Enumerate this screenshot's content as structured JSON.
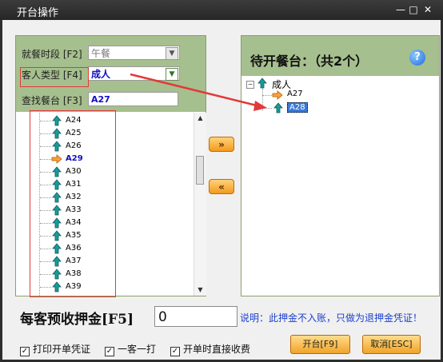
{
  "window": {
    "title": "开台操作",
    "buttons": [
      "—",
      "□",
      "✕"
    ]
  },
  "left_panel": {
    "meal_period": {
      "label": "就餐时段 [F2]",
      "value": "午餐"
    },
    "guest_type": {
      "label": "客人类型 [F4]",
      "value": "成人"
    },
    "find_table": {
      "label": "查找餐台 [F3]",
      "value": "A27"
    },
    "tables": [
      {
        "name": "A24",
        "icon": "up-arrow-icon",
        "selected": false
      },
      {
        "name": "A25",
        "icon": "up-arrow-icon",
        "selected": false
      },
      {
        "name": "A26",
        "icon": "up-arrow-icon",
        "selected": false
      },
      {
        "name": "A29",
        "icon": "right-arrow-icon",
        "selected": true
      },
      {
        "name": "A30",
        "icon": "up-arrow-icon",
        "selected": false
      },
      {
        "name": "A31",
        "icon": "up-arrow-icon",
        "selected": false
      },
      {
        "name": "A32",
        "icon": "up-arrow-icon",
        "selected": false
      },
      {
        "name": "A33",
        "icon": "up-arrow-icon",
        "selected": false
      },
      {
        "name": "A34",
        "icon": "up-arrow-icon",
        "selected": false
      },
      {
        "name": "A35",
        "icon": "up-arrow-icon",
        "selected": false
      },
      {
        "name": "A36",
        "icon": "up-arrow-icon",
        "selected": false
      },
      {
        "name": "A37",
        "icon": "up-arrow-icon",
        "selected": false
      },
      {
        "name": "A38",
        "icon": "up-arrow-icon",
        "selected": false
      },
      {
        "name": "A39",
        "icon": "up-arrow-icon",
        "selected": false
      }
    ]
  },
  "middle": {
    "add_label": "»",
    "remove_label": "«"
  },
  "right_panel": {
    "title": "待开餐台：（共2个）",
    "help": "?",
    "group": {
      "label": "成人",
      "collapse": "−"
    },
    "tables": [
      {
        "name": "A27",
        "icon": "right-arrow-icon",
        "highlighted": false
      },
      {
        "name": "A28",
        "icon": "up-arrow-icon",
        "highlighted": true
      }
    ]
  },
  "deposit": {
    "label": "每客预收押金[F5]",
    "value": "0",
    "note": "说明：此押金不入账，只做为退押金凭证！"
  },
  "options": [
    {
      "label": "打印开单凭证",
      "checked": true
    },
    {
      "label": "一客一打",
      "checked": true
    },
    {
      "label": "开单时直接收费",
      "checked": true
    }
  ],
  "buttons": {
    "open": "开台[F9]",
    "cancel": "取消[ESC]"
  },
  "colors": {
    "panel_header": "#a6bf8e",
    "accent_orange": "#f39a1d",
    "annotation_red": "#e23a3a",
    "note_blue": "#1c3fcf"
  }
}
